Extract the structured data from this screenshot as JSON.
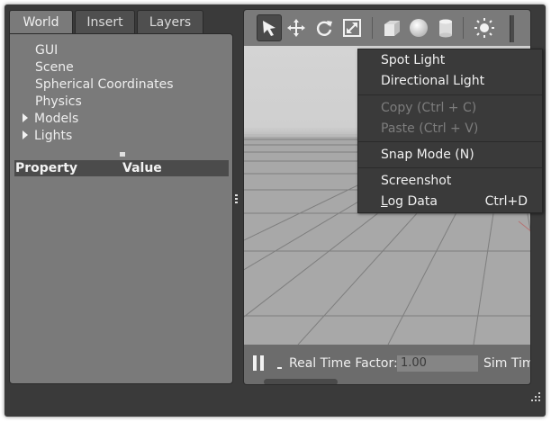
{
  "tabs": [
    {
      "label": "World",
      "active": true
    },
    {
      "label": "Insert",
      "active": false
    },
    {
      "label": "Layers",
      "active": false
    }
  ],
  "tree": {
    "items": [
      {
        "label": "GUI",
        "expandable": false
      },
      {
        "label": "Scene",
        "expandable": false
      },
      {
        "label": "Spherical Coordinates",
        "expandable": false
      },
      {
        "label": "Physics",
        "expandable": false
      },
      {
        "label": "Models",
        "expandable": true
      },
      {
        "label": "Lights",
        "expandable": true
      }
    ]
  },
  "properties": {
    "col_property": "Property",
    "col_value": "Value"
  },
  "toolbar": {
    "icons": [
      "select-arrow-icon",
      "translate-icon",
      "rotate-icon",
      "scale-icon",
      "box-icon",
      "sphere-icon",
      "cylinder-icon",
      "sun-light-icon"
    ]
  },
  "context_menu": {
    "spot_light": "Spot Light",
    "directional_light": "Directional Light",
    "copy": "Copy (Ctrl + C)",
    "paste": "Paste (Ctrl + V)",
    "snap_mode": "Snap Mode (N)",
    "screenshot": "Screenshot",
    "log_data_prefix": "L",
    "log_data_rest": "og Data",
    "log_data_shortcut": "Ctrl+D"
  },
  "bottom_bar": {
    "real_time_factor_label": "Real Time Factor:",
    "real_time_factor_value": "1.00",
    "sim_time_label": "Sim Tim"
  },
  "colors": {
    "panel_bg": "#7a7a7a",
    "window_bg": "#3a3a3a",
    "menu_bg": "#3a3a3a",
    "disabled_text": "#7d7d7d"
  }
}
